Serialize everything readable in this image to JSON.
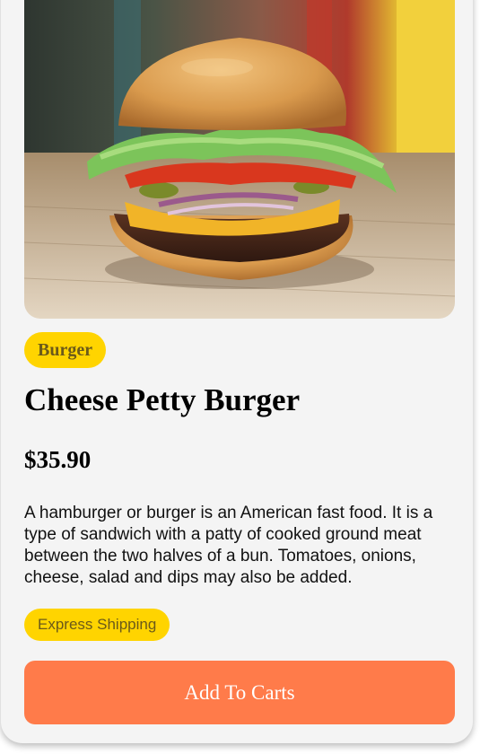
{
  "product": {
    "image_alt": "Cheese burger photo",
    "category": "Burger",
    "name": "Cheese Petty Burger",
    "price": "$35.90",
    "description": "A hamburger or burger is an American fast food. It is a type of sandwich with a patty of cooked ground meat between the two halves of a bun. Tomatoes, onions, cheese, salad and dips may also be added.",
    "shipping": "Express Shipping",
    "add_to_cart_label": "Add To Carts"
  },
  "colors": {
    "badge": "#ffd400",
    "badge_text": "#6b5a1a",
    "button": "#ff7b4a",
    "card": "#f4f4f4"
  }
}
